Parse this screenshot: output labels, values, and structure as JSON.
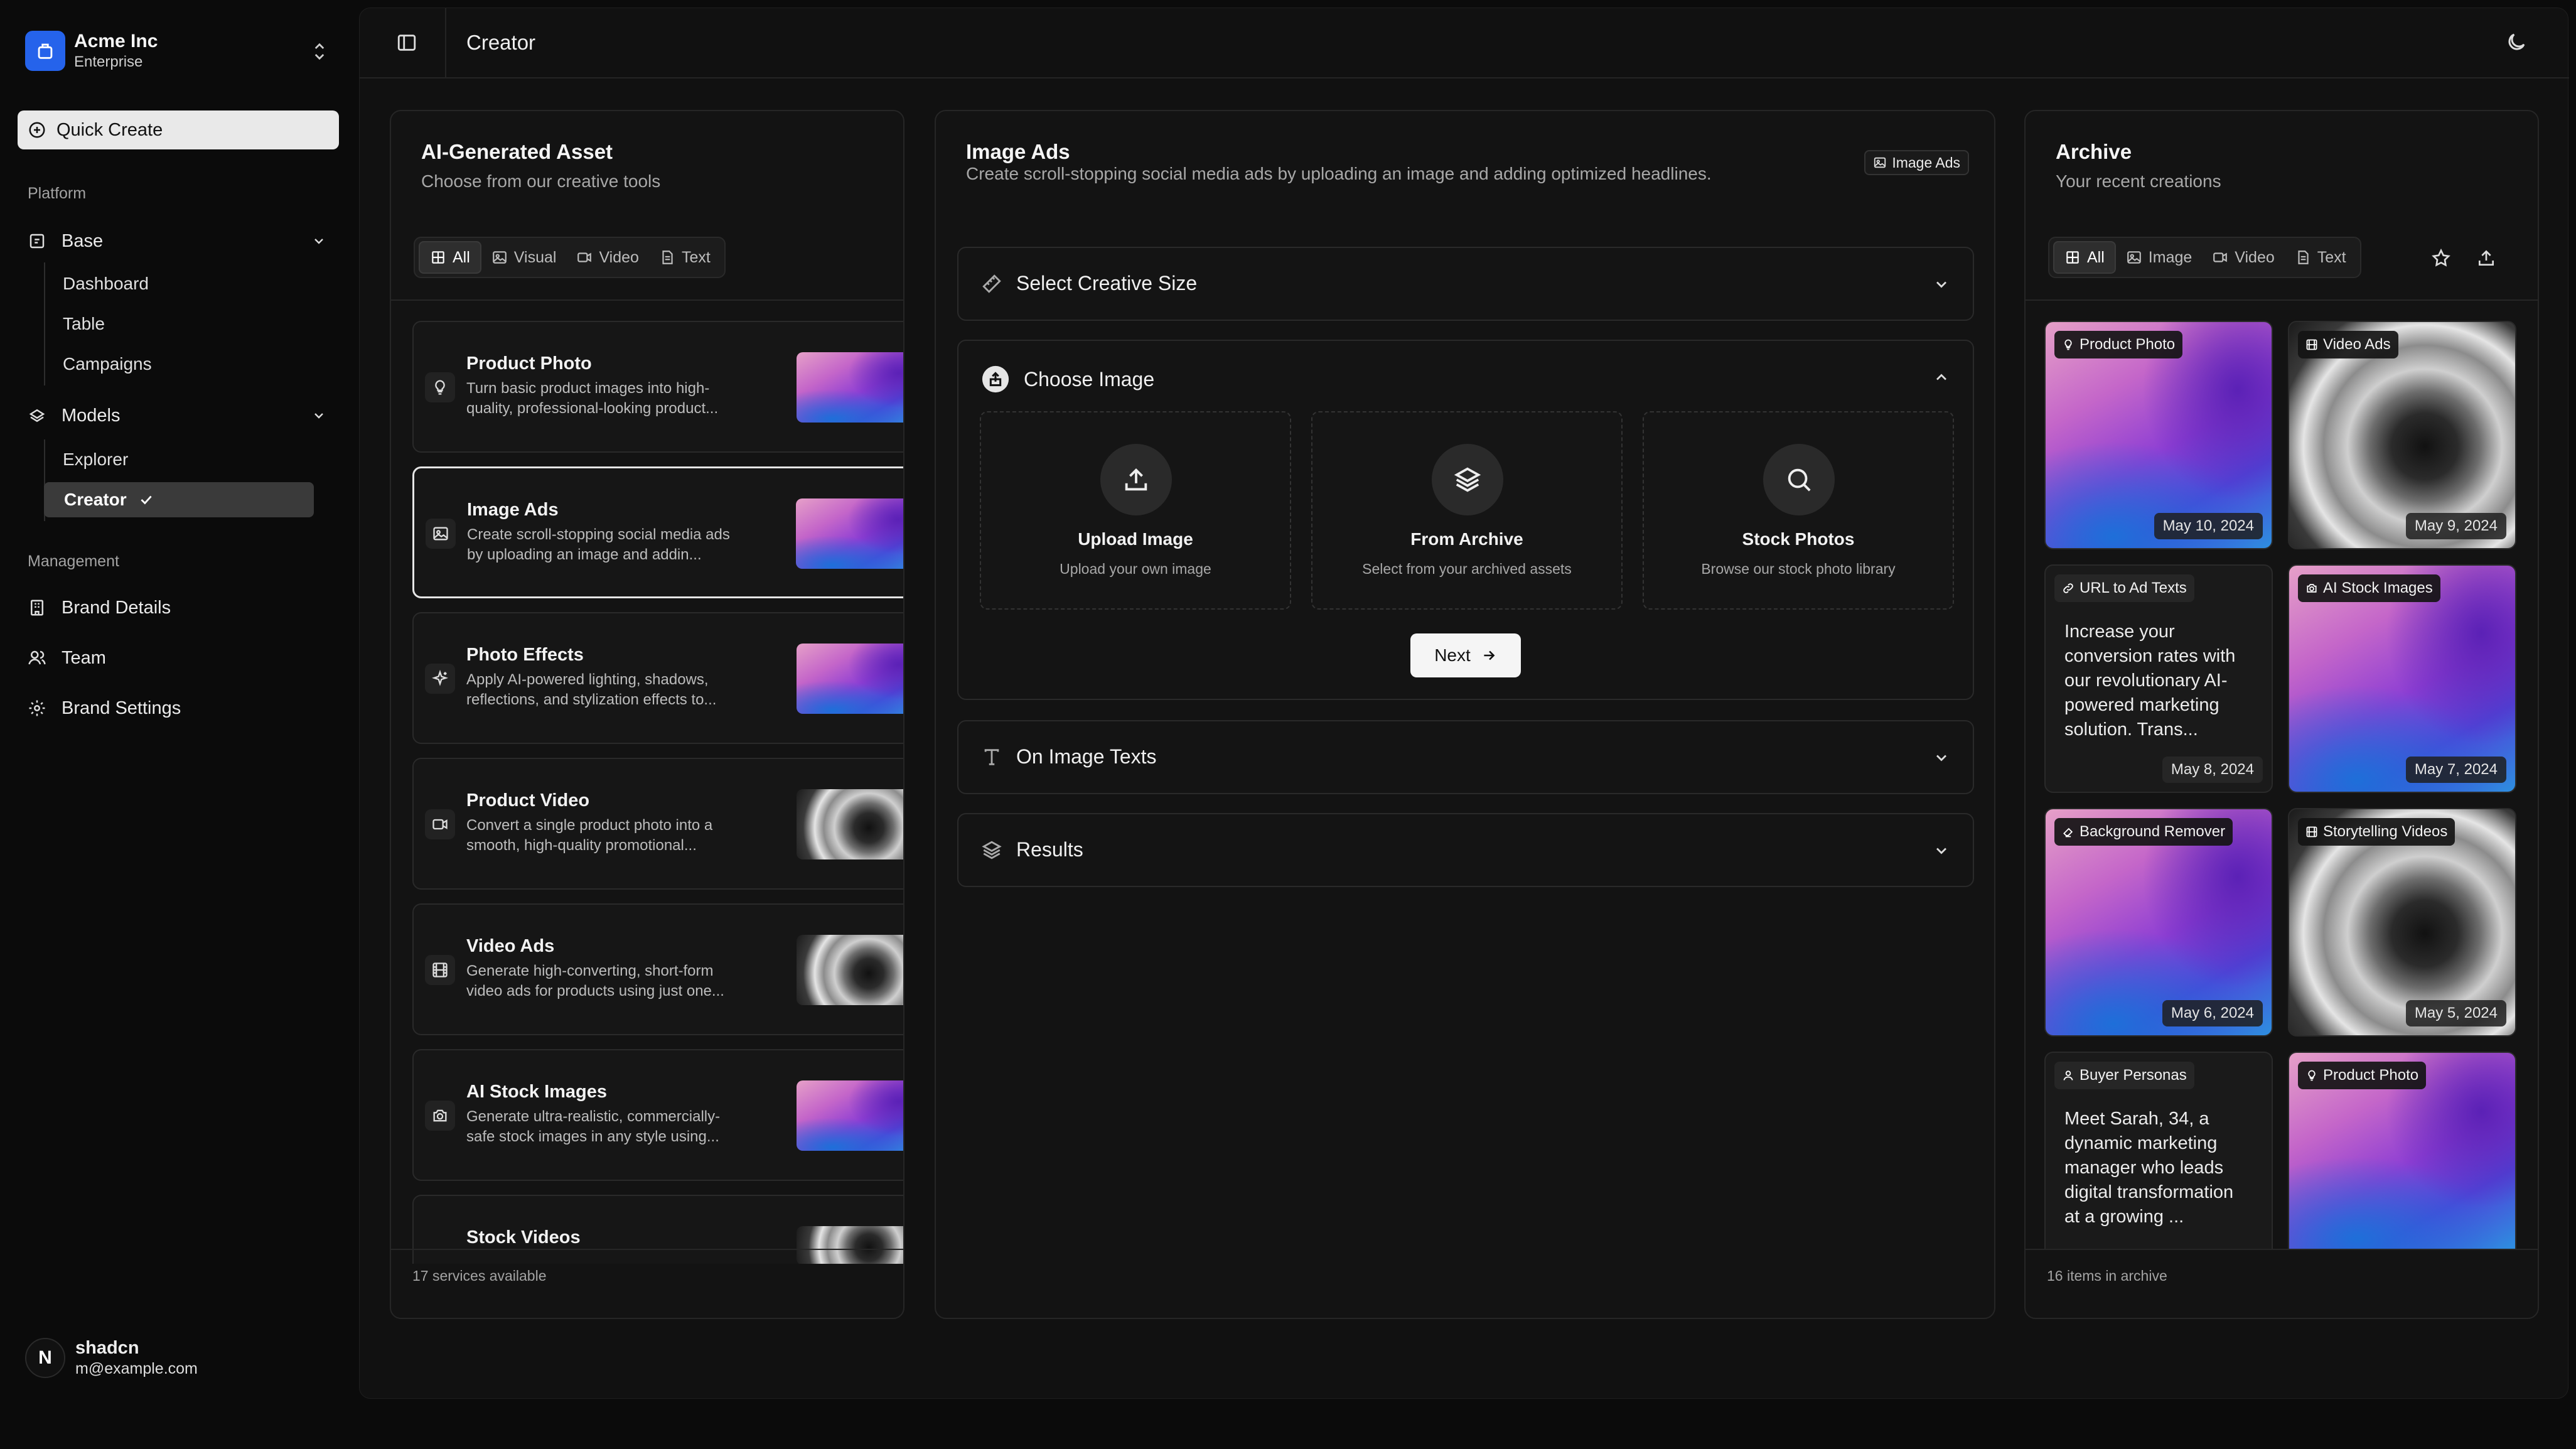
{
  "sidebar": {
    "team": {
      "name": "Acme Inc",
      "plan": "Enterprise"
    },
    "quick_create": "Quick Create",
    "platform_label": "Platform",
    "base": {
      "label": "Base",
      "items": [
        "Dashboard",
        "Table",
        "Campaigns"
      ]
    },
    "models": {
      "label": "Models",
      "items": [
        "Explorer",
        "Creator"
      ]
    },
    "management_label": "Management",
    "management": [
      "Brand Details",
      "Team",
      "Brand Settings"
    ],
    "user": {
      "initial": "N",
      "name": "shadcn",
      "email": "m@example.com"
    }
  },
  "topbar": {
    "title": "Creator"
  },
  "assets": {
    "title": "AI-Generated Asset",
    "subtitle": "Choose from our creative tools",
    "tabs": [
      "All",
      "Visual",
      "Video",
      "Text"
    ],
    "cards": [
      {
        "title": "Product Photo",
        "desc": "Turn basic product images into high-quality, professional-looking product...",
        "thumb": "gradient"
      },
      {
        "title": "Image Ads",
        "desc": "Create scroll-stopping social media ads by uploading an image and addin...",
        "thumb": "gradient"
      },
      {
        "title": "Photo Effects",
        "desc": "Apply AI-powered lighting, shadows, reflections, and stylization effects to...",
        "thumb": "gradient"
      },
      {
        "title": "Product Video",
        "desc": "Convert a single product photo into a smooth, high-quality promotional...",
        "thumb": "vinyl"
      },
      {
        "title": "Video Ads",
        "desc": "Generate high-converting, short-form video ads for products using just one...",
        "thumb": "vinyl"
      },
      {
        "title": "AI Stock Images",
        "desc": "Generate ultra-realistic, commercially-safe stock images in any style using...",
        "thumb": "gradient"
      },
      {
        "title": "Stock Videos",
        "desc": "",
        "thumb": "vinyl"
      }
    ],
    "footer": "17 services available"
  },
  "editor": {
    "title": "Image Ads",
    "subtitle": "Create scroll-stopping social media ads by uploading an image and adding optimized headlines.",
    "badge": "Image Ads",
    "sections": {
      "size": "Select Creative Size",
      "choose": "Choose Image",
      "texts": "On Image Texts",
      "results": "Results"
    },
    "options": [
      {
        "title": "Upload Image",
        "desc": "Upload your own image"
      },
      {
        "title": "From Archive",
        "desc": "Select from your archived assets"
      },
      {
        "title": "Stock Photos",
        "desc": "Browse our stock photo library"
      }
    ],
    "next": "Next"
  },
  "archive": {
    "title": "Archive",
    "subtitle": "Your recent creations",
    "tabs": [
      "All",
      "Image",
      "Video",
      "Text"
    ],
    "tiles": [
      {
        "tag": "Product Photo",
        "date": "May 10, 2024",
        "kind": "gradient"
      },
      {
        "tag": "Video Ads",
        "date": "May 9, 2024",
        "kind": "vinyl"
      },
      {
        "tag": "URL to Ad Texts",
        "date": "May 8, 2024",
        "kind": "text",
        "text": "Increase your conversion rates with our revolutionary AI-powered marketing solution. Trans..."
      },
      {
        "tag": "AI Stock Images",
        "date": "May 7, 2024",
        "kind": "gradient"
      },
      {
        "tag": "Background Remover",
        "date": "May 6, 2024",
        "kind": "gradient"
      },
      {
        "tag": "Storytelling Videos",
        "date": "May 5, 2024",
        "kind": "vinyl"
      },
      {
        "tag": "Buyer Personas",
        "date": "",
        "kind": "text",
        "text": "Meet Sarah, 34, a dynamic marketing manager who leads digital transformation at a growing ..."
      },
      {
        "tag": "Product Photo",
        "date": "",
        "kind": "gradient"
      }
    ],
    "footer": "16 items in archive"
  }
}
